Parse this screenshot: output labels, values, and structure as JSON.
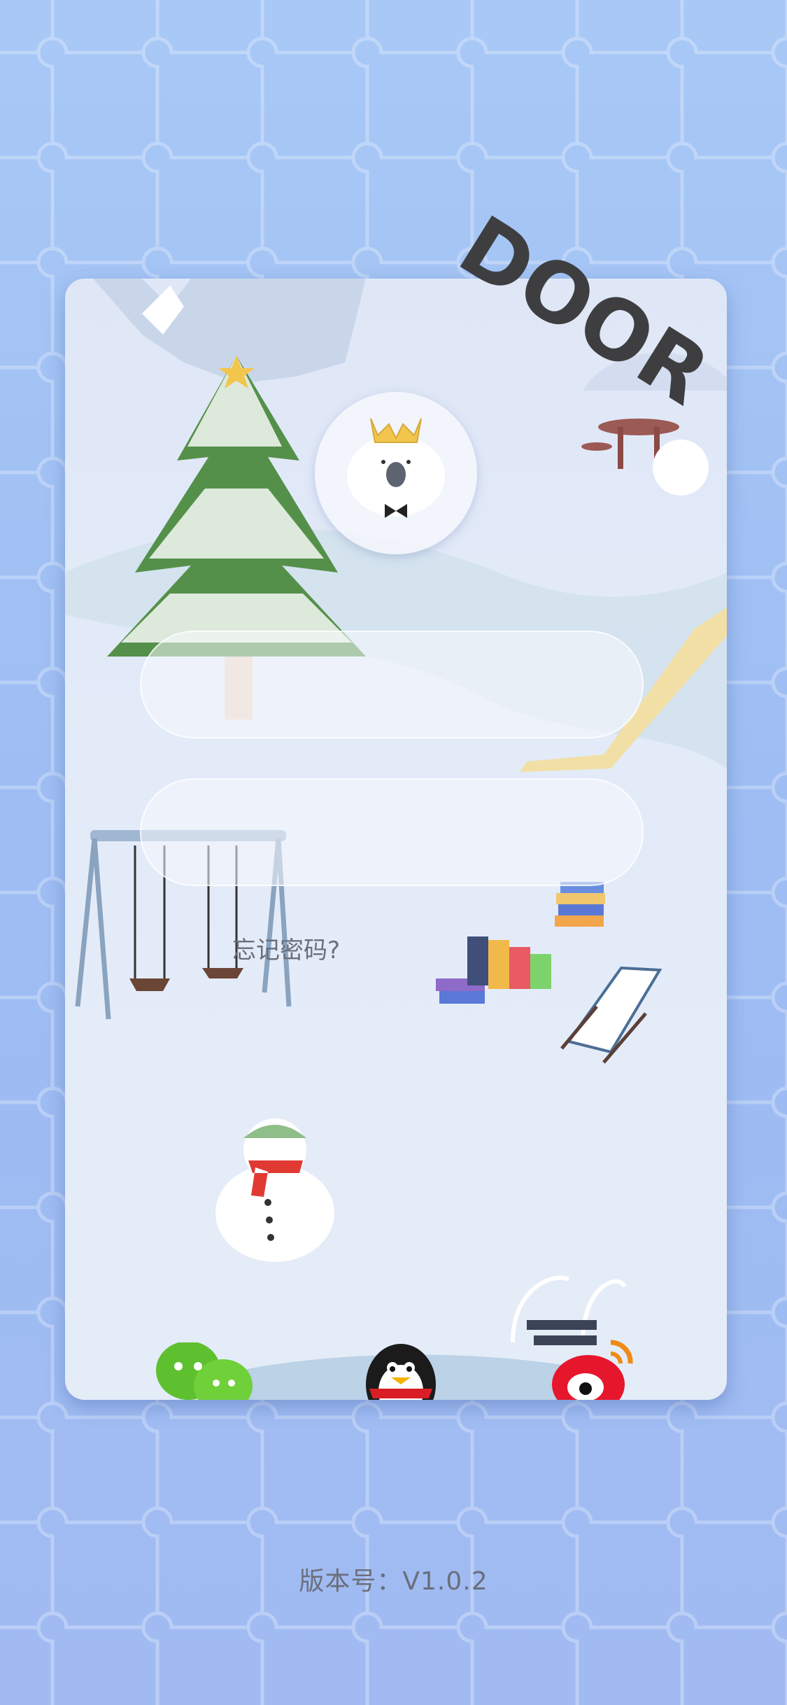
{
  "brand": {
    "logo_text": "DOOR"
  },
  "login": {
    "username_value": "",
    "password_value": "",
    "forgot_password": "忘记密码?"
  },
  "social_logins": [
    {
      "name": "wechat-icon",
      "color": "#5ec02f"
    },
    {
      "name": "qq-icon",
      "color": "#1b1b1b"
    },
    {
      "name": "weibo-icon",
      "color": "#e6162d"
    }
  ],
  "footer": {
    "version": "版本号：V1.0.2"
  },
  "colors": {
    "background": "#a8c8f6",
    "card": "#e1e9f8",
    "text_muted": "#6b6f78"
  }
}
